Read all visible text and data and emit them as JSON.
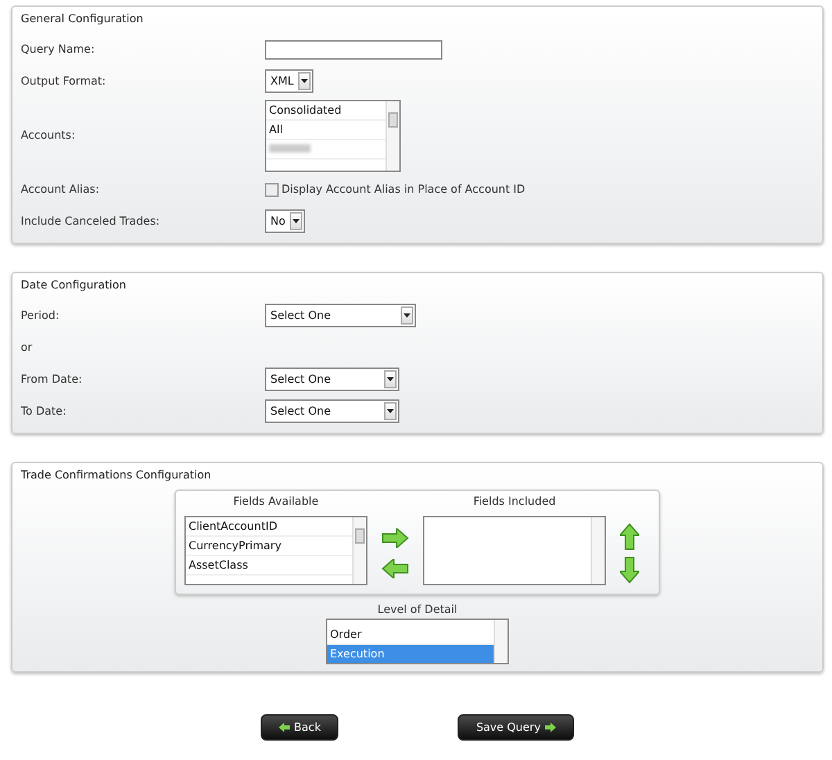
{
  "general": {
    "title": "General Configuration",
    "fields": [
      {
        "kind": "text",
        "label": "Query Name:"
      },
      {
        "kind": "select",
        "label": "Output Format:",
        "value": "XML"
      },
      {
        "kind": "list",
        "label": "Accounts:",
        "options": [
          {
            "text": "Consolidated",
            "selected": false
          },
          {
            "text": "All",
            "selected": false
          }
        ]
      },
      {
        "kind": "checkbox",
        "label": "Account Alias:",
        "text": "Display Account Alias in Place of Account ID",
        "checked": false
      },
      {
        "kind": "select",
        "label": "Include Canceled Trades:",
        "value": "No"
      }
    ]
  },
  "date": {
    "title": "Date Configuration",
    "fields": [
      {
        "kind": "select",
        "label": "Period:",
        "value": "Select One"
      },
      {
        "kind": "note",
        "label": "or"
      },
      {
        "kind": "select",
        "label": "From Date:",
        "value": "Select One"
      },
      {
        "kind": "select",
        "label": "To Date:",
        "value": "Select One"
      }
    ]
  },
  "trade": {
    "title": "Trade Confirmations Configuration",
    "fields_available": {
      "heading": "Fields Available",
      "items": [
        "ClientAccountID",
        "CurrencyPrimary",
        "AssetClass"
      ]
    },
    "fields_included": {
      "heading": "Fields Included"
    },
    "level_of_detail": {
      "heading": "Level of Detail",
      "items": [
        {
          "text": "Order",
          "selected": false
        },
        {
          "text": "Execution",
          "selected": true
        }
      ]
    }
  },
  "buttons": [
    {
      "kind": "back",
      "label": "Back"
    },
    {
      "kind": "save",
      "label": "Save Query"
    }
  ]
}
